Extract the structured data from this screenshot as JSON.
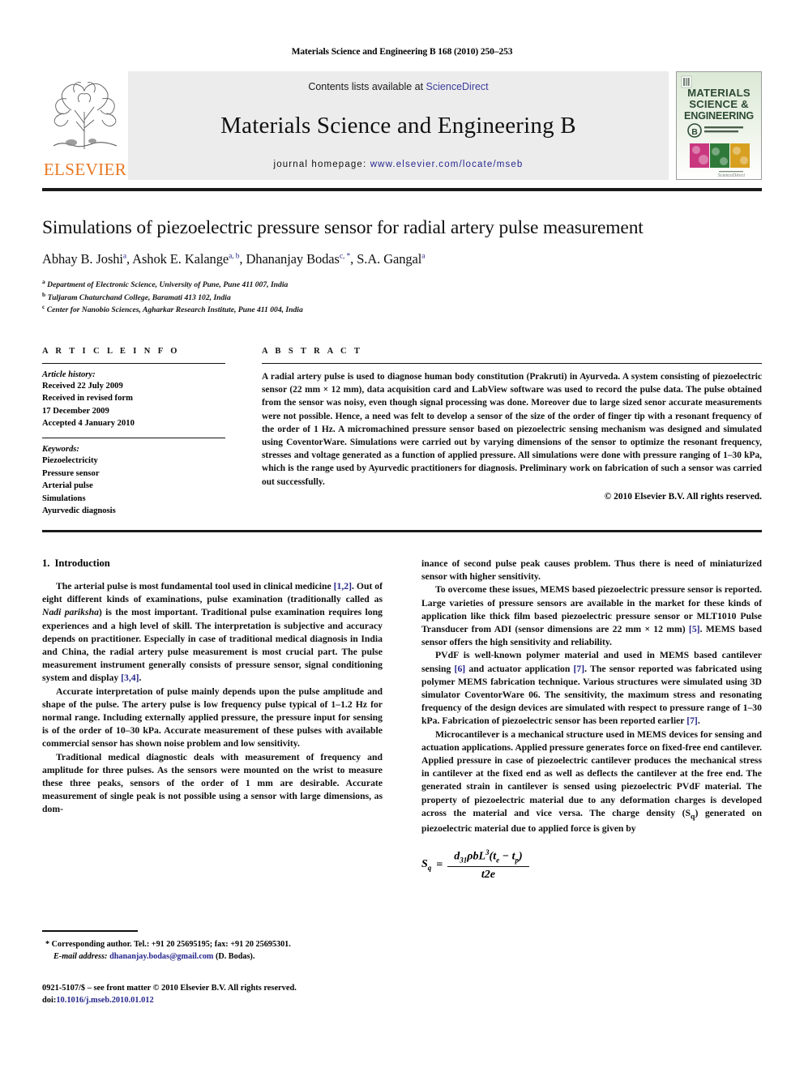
{
  "running_head": "Materials Science and Engineering B 168 (2010) 250–253",
  "masthead": {
    "publisher_name": "ELSEVIER",
    "contents_prefix": "Contents lists available at ",
    "contents_link": "ScienceDirect",
    "journal_title": "Materials Science and Engineering B",
    "homepage_prefix": "journal homepage: ",
    "homepage_url": "www.elsevier.com/locate/mseb",
    "cover": {
      "line1": "MATERIALS",
      "line2": "SCIENCE &",
      "line3": "ENGINEERING",
      "series_badge": "B",
      "series_sub1": "ADVANCED FUNCTIONAL",
      "series_sub2": "SOLID-STATE MATERIALS",
      "footer": "ScienceDirect"
    }
  },
  "title": "Simulations of piezoelectric pressure sensor for radial artery pulse measurement",
  "authors": [
    {
      "name": "Abhay B. Joshi",
      "marks": "a"
    },
    {
      "name": "Ashok E. Kalange",
      "marks": "a, b"
    },
    {
      "name": "Dhananjay Bodas",
      "marks": "c, *"
    },
    {
      "name": "S.A. Gangal",
      "marks": "a"
    }
  ],
  "affiliations": [
    {
      "mark": "a",
      "text": "Department of Electronic Science, University of Pune, Pune 411 007, India"
    },
    {
      "mark": "b",
      "text": "Tuljaram Chaturchand College, Baramati 413 102, India"
    },
    {
      "mark": "c",
      "text": "Center for Nanobio Sciences, Agharkar Research Institute, Pune 411 004, India"
    }
  ],
  "article_info": {
    "heading": "A R T I C L E   I N F O",
    "history_label": "Article history:",
    "history": [
      "Received 22 July 2009",
      "Received in revised form",
      "17 December 2009",
      "Accepted 4 January 2010"
    ],
    "keywords_label": "Keywords:",
    "keywords": [
      "Piezoelectricity",
      "Pressure sensor",
      "Arterial pulse",
      "Simulations",
      "Ayurvedic diagnosis"
    ]
  },
  "abstract": {
    "heading": "A B S T R A C T",
    "text": "A radial artery pulse is used to diagnose human body constitution (Prakruti) in Ayurveda. A system consisting of piezoelectric sensor (22 mm × 12 mm), data acquisition card and LabView software was used to record the pulse data. The pulse obtained from the sensor was noisy, even though signal processing was done. Moreover due to large sized senor accurate measurements were not possible. Hence, a need was felt to develop a sensor of the size of the order of finger tip with a resonant frequency of the order of 1 Hz. A micromachined pressure sensor based on piezoelectric sensing mechanism was designed and simulated using CoventorWare. Simulations were carried out by varying dimensions of the sensor to optimize the resonant frequency, stresses and voltage generated as a function of applied pressure. All simulations were done with pressure ranging of 1–30 kPa, which is the range used by Ayurvedic practitioners for diagnosis. Preliminary work on fabrication of such a sensor was carried out successfully.",
    "copyright": "© 2010 Elsevier B.V. All rights reserved."
  },
  "introduction": {
    "number": "1.",
    "heading": "Introduction",
    "left_paragraphs": [
      {
        "segments": [
          {
            "t": "The arterial pulse is most fundamental tool used in clinical medicine "
          },
          {
            "t": "[1,2]",
            "s": "ref"
          },
          {
            "t": ". Out of eight different kinds of examinations, pulse examination (traditionally called as "
          },
          {
            "t": "Nadi pariksha",
            "s": "it"
          },
          {
            "t": ") is the most important. Traditional pulse examination requires long experiences and a high level of skill. The interpretation is subjective and accuracy depends on practitioner. Especially in case of traditional medical diagnosis in India and China, the radial artery pulse measurement is most crucial part. The pulse measurement instrument generally consists of pressure sensor, signal conditioning system and display "
          },
          {
            "t": "[3,4]",
            "s": "ref"
          },
          {
            "t": "."
          }
        ]
      },
      {
        "segments": [
          {
            "t": "Accurate interpretation of pulse mainly depends upon the pulse amplitude and shape of the pulse. The artery pulse is low frequency pulse typical of 1–1.2 Hz for normal range. Including externally applied pressure, the pressure input for sensing is of the order of 10–30 kPa. Accurate measurement of these pulses with available commercial sensor has shown noise problem and low sensitivity."
          }
        ]
      },
      {
        "segments": [
          {
            "t": "Traditional medical diagnostic deals with measurement of frequency and amplitude for three pulses. As the sensors were mounted on the wrist to measure these three peaks, sensors of the order of 1 mm are desirable. Accurate measurement of single peak is not possible using a sensor with large dimensions, as dom-"
          }
        ]
      }
    ],
    "right_paragraphs": [
      {
        "continued": true,
        "segments": [
          {
            "t": "inance of second pulse peak causes problem. Thus there is need of miniaturized sensor with higher sensitivity."
          }
        ]
      },
      {
        "segments": [
          {
            "t": "To overcome these issues, MEMS based piezoelectric pressure sensor is reported. Large varieties of pressure sensors are available in the market for these kinds of application like thick film based piezoelectric pressure sensor or MLT1010 Pulse Transducer from ADI (sensor dimensions are 22 mm × 12 mm) "
          },
          {
            "t": "[5]",
            "s": "ref"
          },
          {
            "t": ". MEMS based sensor offers the high sensitivity and reliability."
          }
        ]
      },
      {
        "segments": [
          {
            "t": "PVdF is well-known polymer material and used in MEMS based cantilever sensing "
          },
          {
            "t": "[6]",
            "s": "ref"
          },
          {
            "t": " and actuator application "
          },
          {
            "t": "[7]",
            "s": "ref"
          },
          {
            "t": ". The sensor reported was fabricated using polymer MEMS fabrication technique. Various structures were simulated using 3D simulator CoventorWare 06. The sensitivity, the maximum stress and resonating frequency of the design devices are simulated with respect to pressure range of 1–30 kPa. Fabrication of piezoelectric sensor has been reported earlier "
          },
          {
            "t": "[7]",
            "s": "ref"
          },
          {
            "t": "."
          }
        ]
      },
      {
        "segments": [
          {
            "t": "Microcantilever is a mechanical structure used in MEMS devices for sensing and actuation applications. Applied pressure generates force on fixed-free end cantilever. Applied pressure in case of piezoelectric cantilever produces the mechanical stress in cantilever at the fixed end as well as deflects the cantilever at the free end. The generated strain in cantilever is sensed using piezoelectric PVdF material. The property of piezoelectric material due to any deformation charges is developed across the material and vice versa. The charge density (S"
          },
          {
            "t": "q",
            "s": "sub"
          },
          {
            "t": ") generated on piezoelectric material due to applied force is given by"
          }
        ]
      }
    ]
  },
  "equation": {
    "lhs": "S",
    "lhs_sub": "q",
    "eq": "=",
    "numerator": "d31ρbL3(te − tp)",
    "denominator": "t2e"
  },
  "footnotes": {
    "corresponding": "* Corresponding author. Tel.: +91 20 25695195; fax: +91 20 25695301.",
    "email_label": "E-mail address:",
    "email": "dhananjay.bodas@gmail.com",
    "email_suffix": "(D. Bodas).",
    "issn_line": "0921-5107/$ – see front matter © 2010 Elsevier B.V. All rights reserved.",
    "doi_label": "doi:",
    "doi_value": "10.1016/j.mseb.2010.01.012"
  },
  "colors": {
    "link": "#26268c",
    "elsevier_orange": "#E87722",
    "masthead_bg": "#ececec"
  }
}
